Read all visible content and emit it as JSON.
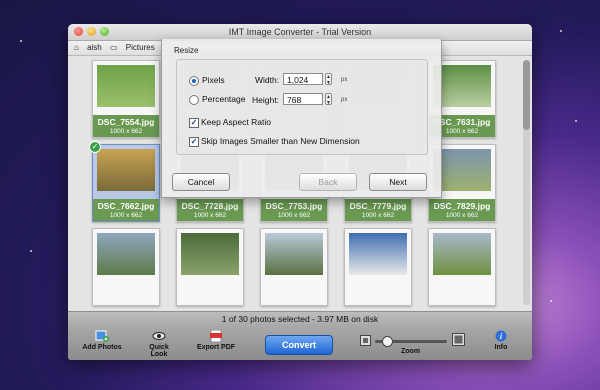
{
  "window": {
    "title": "IMT Image Converter - Trial Version"
  },
  "pathbar": {
    "crumbs": [
      "aish",
      "Pictures"
    ]
  },
  "photos": [
    {
      "name": "DSC_7554.jpg",
      "size": "1000 x 662",
      "thumb_colors": [
        "#6fa24a",
        "#9ac06a"
      ],
      "selected": false
    },
    {
      "name": "",
      "size": "",
      "thumb_colors": [
        "#8c8c8c",
        "#b0b0b0"
      ],
      "selected": false
    },
    {
      "name": "",
      "size": "",
      "thumb_colors": [
        "#8c8c8c",
        "#b0b0b0"
      ],
      "selected": false
    },
    {
      "name": "",
      "size": "",
      "thumb_colors": [
        "#8c8c8c",
        "#b0b0b0"
      ],
      "selected": false
    },
    {
      "name": "DSC_7631.jpg",
      "size": "1000 x 662",
      "thumb_colors": [
        "#5f8f46",
        "#b9cfa0"
      ],
      "selected": false
    },
    {
      "name": "DSC_7662.jpg",
      "size": "1000 x 662",
      "thumb_colors": [
        "#c9a352",
        "#7a6a3a"
      ],
      "selected": true
    },
    {
      "name": "DSC_7728.jpg",
      "size": "1000 x 662",
      "thumb_colors": [
        "#808080",
        "#a8a8a8"
      ],
      "selected": false
    },
    {
      "name": "DSC_7753.jpg",
      "size": "1000 x 662",
      "thumb_colors": [
        "#808080",
        "#a8a8a8"
      ],
      "selected": false
    },
    {
      "name": "DSC_7779.jpg",
      "size": "1000 x 662",
      "thumb_colors": [
        "#808080",
        "#a8a8a8"
      ],
      "selected": false
    },
    {
      "name": "DSC_7829.jpg",
      "size": "1000 x 662",
      "thumb_colors": [
        "#7d95ad",
        "#9db16d"
      ],
      "selected": false
    },
    {
      "name": "",
      "size": "",
      "thumb_colors": [
        "#8fa7bd",
        "#5e7a48"
      ],
      "selected": false
    },
    {
      "name": "",
      "size": "",
      "thumb_colors": [
        "#4c6a3a",
        "#8aa36a"
      ],
      "selected": false
    },
    {
      "name": "",
      "size": "",
      "thumb_colors": [
        "#b9c9d9",
        "#5a7042"
      ],
      "selected": false
    },
    {
      "name": "",
      "size": "",
      "thumb_colors": [
        "#3f6fb0",
        "#e9e9e9"
      ],
      "selected": false
    },
    {
      "name": "",
      "size": "",
      "thumb_colors": [
        "#a9b9c9",
        "#6f9040"
      ],
      "selected": false
    }
  ],
  "status": {
    "text": "1 of 30 photos selected - 3.97 MB on disk"
  },
  "toolbar": {
    "add_photos": "Add Photos",
    "quick_look": "Quick Look",
    "export_pdf": "Export PDF",
    "convert": "Convert",
    "zoom": "Zoom",
    "info": "Info",
    "zoom_level": 0.15
  },
  "dialog": {
    "title": "Resize",
    "pixels_label": "Pixels",
    "percentage_label": "Percentage",
    "selected_mode": "Pixels",
    "width_label": "Width:",
    "width_value": "1,024",
    "height_label": "Height:",
    "height_value": "768",
    "unit": "px",
    "keep_aspect_label": "Keep Aspect Ratio",
    "keep_aspect_checked": true,
    "skip_smaller_label": "Skip Images Smaller than New Dimension",
    "skip_smaller_checked": true,
    "cancel": "Cancel",
    "back": "Back",
    "next": "Next"
  }
}
